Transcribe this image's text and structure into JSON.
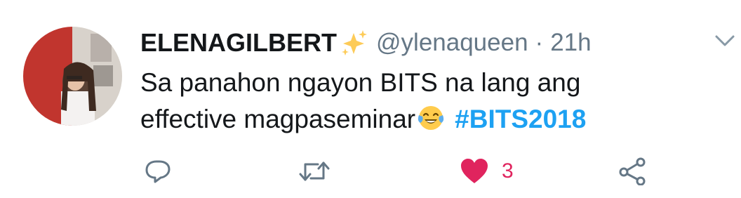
{
  "tweet": {
    "display_name": "ELENAGILBERT",
    "handle": "@ylenaqueen",
    "separator": "·",
    "time": "21h",
    "text_line1": "Sa panahon ngayon BITS na lang ang",
    "text_line2": "effective magpaseminar",
    "hashtag": "#BITS2018",
    "likes": "3"
  },
  "icons": {
    "name_badge": "sparkles-icon",
    "emoji": "face-with-tears-of-joy-icon",
    "reply": "reply-icon",
    "retweet": "retweet-icon",
    "like": "heart-icon",
    "share": "share-icon",
    "caret": "chevron-down-icon"
  },
  "colors": {
    "text": "#14171a",
    "secondary": "#657786",
    "hashtag": "#1da1f2",
    "like": "#e0245e",
    "icon": "#657786"
  }
}
